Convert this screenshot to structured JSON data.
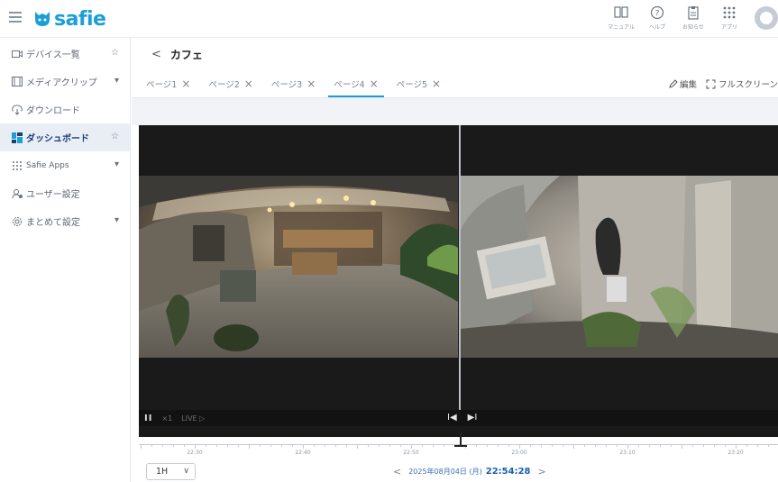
{
  "app": {
    "brand": "safie"
  },
  "header": {
    "icons": [
      {
        "icon": "book-icon",
        "label": "マニュアル"
      },
      {
        "icon": "help-icon",
        "label": "ヘルプ"
      },
      {
        "icon": "clipboard-icon",
        "label": "お知らせ"
      },
      {
        "icon": "apps-icon",
        "label": "アプリ"
      }
    ]
  },
  "sidebar": {
    "items": [
      {
        "icon": "camera-icon",
        "label": "デバイス一覧",
        "right": "☆"
      },
      {
        "icon": "film-icon",
        "label": "メディアクリップ",
        "right": "▾"
      },
      {
        "icon": "download-icon",
        "label": "ダウンロード",
        "right": ""
      },
      {
        "icon": "dashboard-icon",
        "label": "ダッシュボード",
        "right": "☆"
      },
      {
        "icon": "grid-icon",
        "label": "Safie Apps",
        "right": "▾"
      },
      {
        "icon": "users-icon",
        "label": "ユーザー設定",
        "right": ""
      },
      {
        "icon": "settings-icon",
        "label": "まとめて設定",
        "right": "▾"
      }
    ]
  },
  "breadcrumb": {
    "back": "<",
    "title": "カフェ"
  },
  "tabs": [
    {
      "label": "ページ1",
      "active": false
    },
    {
      "label": "ページ2",
      "active": false
    },
    {
      "label": "ページ3",
      "active": false
    },
    {
      "label": "ページ4",
      "active": true
    },
    {
      "label": "ページ5",
      "active": false
    }
  ],
  "tab_actions": {
    "edit": "編集",
    "fullscreen": "フルスクリーン"
  },
  "player": {
    "pause": "II",
    "speed": "×1",
    "live": "LIVE ▷",
    "prev": "I◀",
    "next": "▶I"
  },
  "timeline": {
    "labels": [
      "22:30",
      "22:40",
      "22:50",
      "23:00",
      "23:10",
      "23:20"
    ]
  },
  "footer": {
    "range": "1H",
    "prev": "<",
    "date": "2025年08月04日 (月)",
    "time": "22:54:28",
    "next": ">"
  },
  "colors": {
    "brand": "#1a9fd8",
    "active_nav": "#1b3d73",
    "time": "#1b5fb0"
  }
}
